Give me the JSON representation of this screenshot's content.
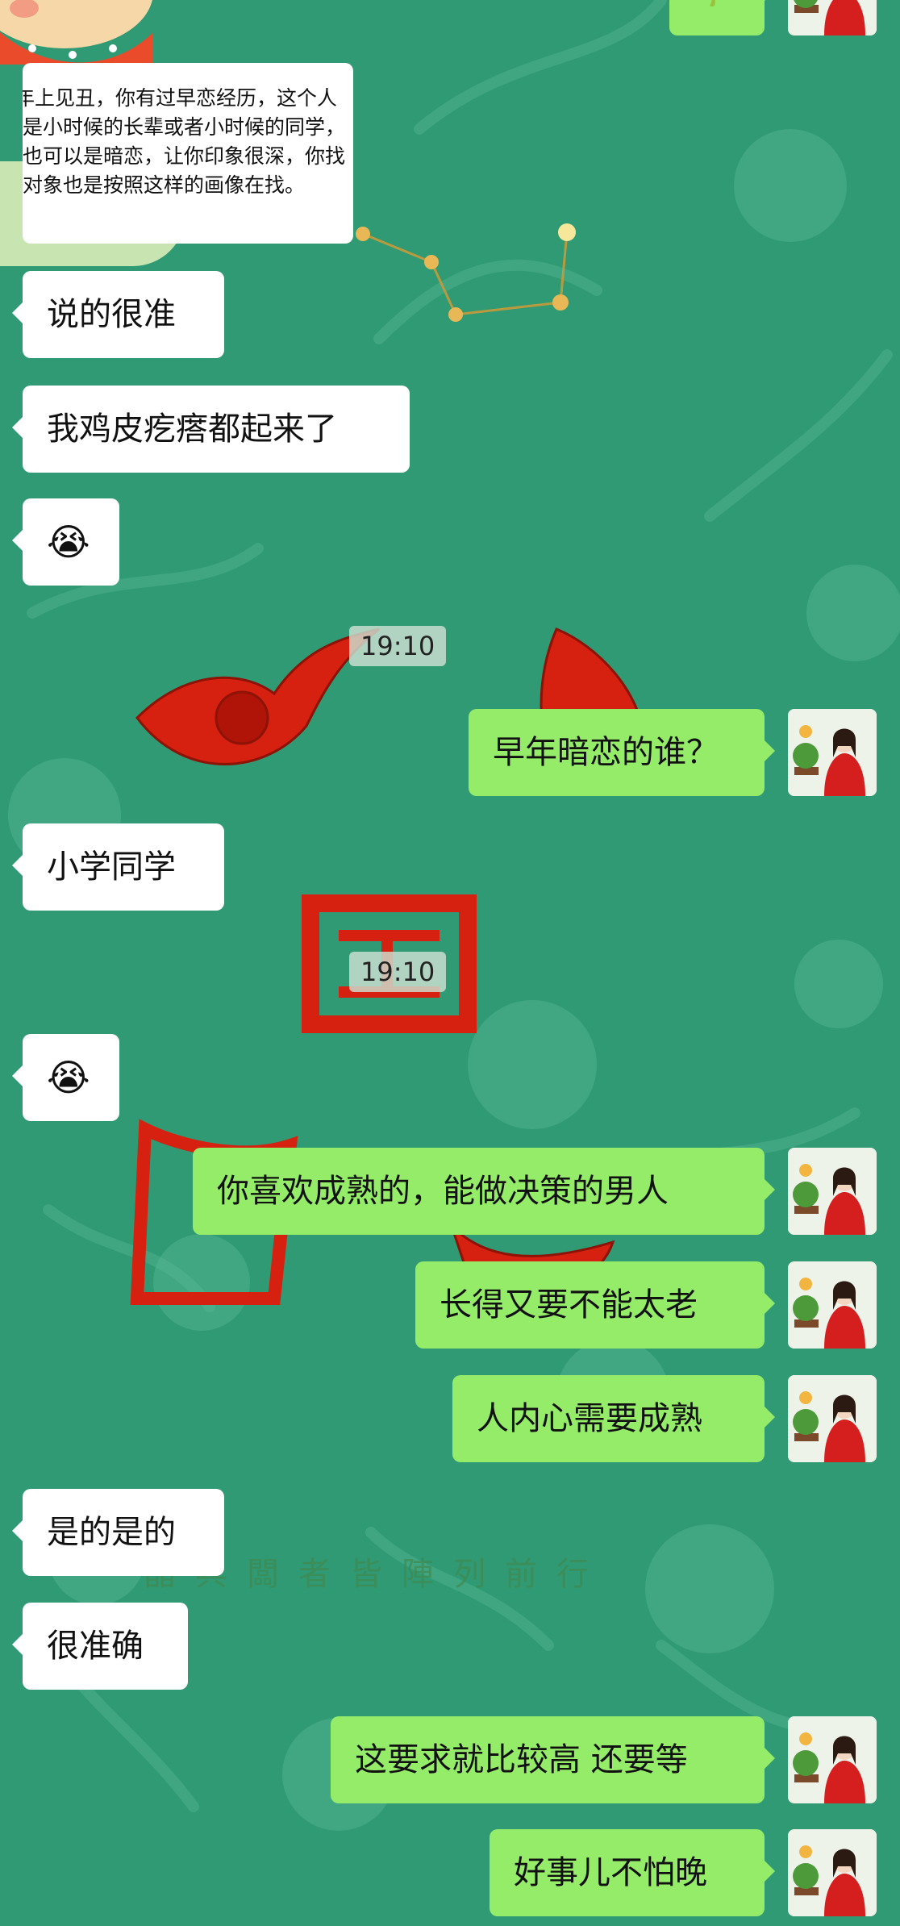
{
  "colors": {
    "background": "#2f9a74",
    "incoming_bubble": "#ffffff",
    "outgoing_bubble": "#95ec69",
    "ornament_red": "#d62010"
  },
  "timestamps": [
    "19:10",
    "19:10"
  ],
  "background_caption": "晶兵闆者皆陣列前行",
  "messages": [
    {
      "side": "out",
      "text": "🌱",
      "kind": "partial"
    },
    {
      "side": "in",
      "text": "年上见丑，你有过早恋经历，这个人是小时候的长辈或者小时候的同学，也可以是暗恋，让你印象很深，你找对象也是按照这样的画像在找。",
      "kind": "text-cut"
    },
    {
      "side": "in",
      "text": "说的很准"
    },
    {
      "side": "in",
      "text": "我鸡皮疙瘩都起来了"
    },
    {
      "side": "in",
      "text": "😭",
      "kind": "emoji"
    },
    {
      "side": "out",
      "text": "早年暗恋的谁？"
    },
    {
      "side": "in",
      "text": "小学同学"
    },
    {
      "side": "in",
      "text": "😭",
      "kind": "emoji"
    },
    {
      "side": "out",
      "text": "你喜欢成熟的，能做决策的男人"
    },
    {
      "side": "out",
      "text": "长得又要不能太老"
    },
    {
      "side": "out",
      "text": "人内心需要成熟"
    },
    {
      "side": "in",
      "text": "是的是的"
    },
    {
      "side": "in",
      "text": "很准确"
    },
    {
      "side": "out",
      "text": "这要求就比较高 还要等"
    },
    {
      "side": "out",
      "text": "好事儿不怕晚"
    }
  ],
  "icons": {
    "avatar": "avatar-red-dress-woman-icon",
    "sticker": "cartoon-sticker-icon"
  }
}
